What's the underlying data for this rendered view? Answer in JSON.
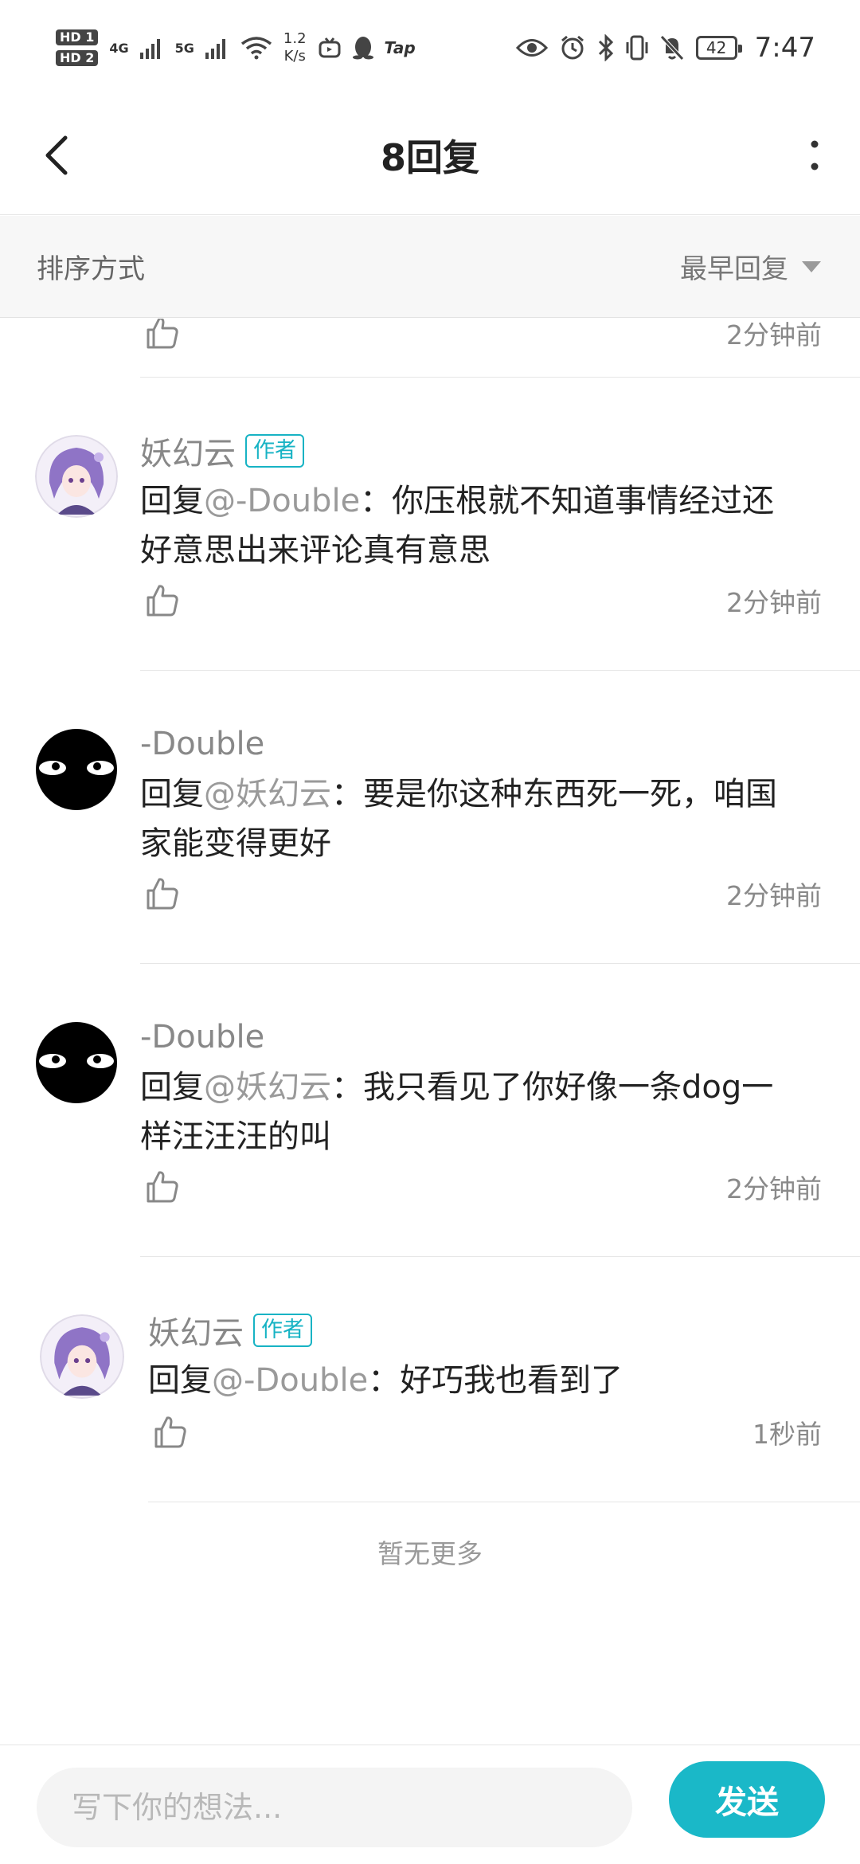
{
  "status_bar": {
    "hd1": "HD 1",
    "hd2": "HD 2",
    "net1": "4G",
    "net2": "5G",
    "speed_value": "1.2",
    "speed_unit": "K/s",
    "app_tap": "Tap",
    "battery": "42",
    "time": "7:47"
  },
  "header": {
    "title": "8回复"
  },
  "sort": {
    "label": "排序方式",
    "selected": "最早回复"
  },
  "partial_row": {
    "time": "2分钟前"
  },
  "comments": [
    {
      "name": "妖幻云",
      "badge": "作者",
      "reply_prefix": "回复",
      "mention": "@-Double",
      "text_line1": "：你压根就不知道事情经过还",
      "text_line2": "好意思出来评论真有意思",
      "time": "2分钟前",
      "avatar": "anime-girl"
    },
    {
      "name": "-Double",
      "badge": "",
      "reply_prefix": "回复",
      "mention": "@妖幻云",
      "text_line1": "：要是你这种东西死一死，咱国",
      "text_line2": "家能变得更好",
      "time": "2分钟前",
      "avatar": "black-eyes"
    },
    {
      "name": "-Double",
      "badge": "",
      "reply_prefix": "回复",
      "mention": "@妖幻云",
      "text_line1": "：我只看见了你好像一条dog一",
      "text_line2": "样汪汪汪的叫",
      "time": "2分钟前",
      "avatar": "black-eyes"
    },
    {
      "name": "妖幻云",
      "badge": "作者",
      "reply_prefix": "回复",
      "mention": "@-Double",
      "text_line1": "：好巧我也看到了",
      "text_line2": "",
      "time": "1秒前",
      "avatar": "anime-girl"
    }
  ],
  "footer_text": "暂无更多",
  "composer": {
    "placeholder": "写下你的想法...",
    "send_label": "发送"
  },
  "colors": {
    "accent": "#1ab8c8",
    "badge": "#17b3c4",
    "mention": "#9a9a9a"
  }
}
